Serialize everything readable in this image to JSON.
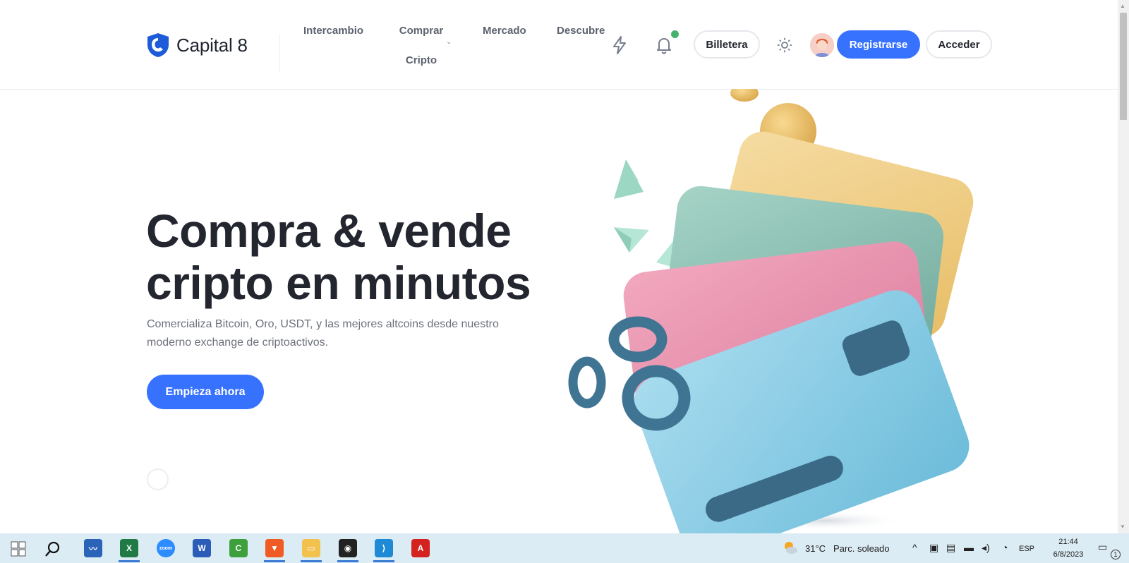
{
  "brand": {
    "name": "Capital 8",
    "accent": "#3772ff"
  },
  "nav": {
    "items": [
      "Intercambio",
      "Comprar Cripto",
      "Mercado",
      "Descubre"
    ],
    "buy_line1": "Comprar",
    "buy_line2": "Cripto"
  },
  "header_actions": {
    "lightning_icon": "lightning-icon",
    "bell_icon": "bell-icon",
    "notification_dot_color": "#45b26b",
    "wallet_label": "Billetera",
    "theme_icon": "sun-icon",
    "register_label": "Registrarse",
    "login_label": "Acceder"
  },
  "hero": {
    "title_line1": "Compra & vende",
    "title_line2": "cripto en minutos",
    "subtitle": "Comercializa Bitcoin, Oro, USDT, y las mejores altcoins desde nuestro moderno exchange de criptoactivos.",
    "cta_label": "Empieza ahora"
  },
  "taskbar": {
    "apps": [
      "Explorador de tareas",
      "Excel",
      "Zoom",
      "Word",
      "Camtasia",
      "Brave",
      "Explorador de archivos",
      "Incognito",
      "Visual Studio Code",
      "Adobe Acrobat"
    ],
    "weather_temp": "31°C",
    "weather_desc": "Parc. soleado",
    "language": "ESP",
    "time": "21:44",
    "date": "6/8/2023",
    "notification_count": "1"
  }
}
